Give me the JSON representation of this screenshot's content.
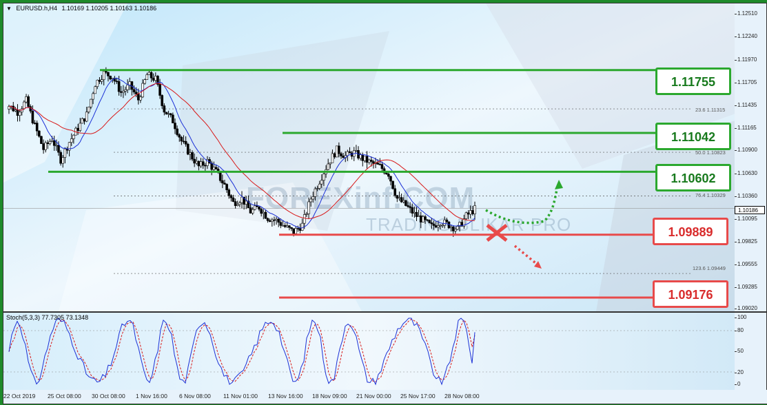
{
  "chart_header": {
    "menu_icon": "triangle-down-icon",
    "symbol": "EURUSD.h,H4",
    "ohlc": "1.10169 1.10205 1.10163 1.10186"
  },
  "stoch_header": {
    "label": "Stoch(5,3,3) 77.7305 73.1348"
  },
  "price_axis": {
    "ticks": [
      "1.12510",
      "1.12240",
      "1.11970",
      "1.11705",
      "1.11435",
      "1.11165",
      "1.10900",
      "1.10630",
      "1.10360",
      "1.10095",
      "1.09825",
      "1.09555",
      "1.09285",
      "1.09020"
    ],
    "current_price": "1.10186"
  },
  "stoch_axis": {
    "ticks": [
      "100",
      "80",
      "50",
      "20",
      "0"
    ]
  },
  "time_axis": {
    "labels": [
      "22 Oct 2019",
      "25 Oct 08:00",
      "30 Oct 08:00",
      "1 Nov 16:00",
      "6 Nov 08:00",
      "11 Nov 01:00",
      "13 Nov 16:00",
      "18 Nov 09:00",
      "21 Nov 00:00",
      "25 Nov 17:00",
      "28 Nov 08:00"
    ]
  },
  "levels": [
    {
      "price": "1.11755",
      "color": "green"
    },
    {
      "price": "1.11042",
      "color": "green"
    },
    {
      "price": "1.10602",
      "color": "green"
    },
    {
      "price": "1.09889",
      "color": "red"
    },
    {
      "price": "1.09176",
      "color": "red"
    }
  ],
  "fib_labels": [
    "23.6 1.11315",
    "50.0 1.10823",
    "76.4 1.10329",
    "123.6 1.09449"
  ],
  "watermark": {
    "brand": "FOREXinf.COM",
    "sub": "TRADING BLIKAR PRO"
  },
  "colors": {
    "frame": "#1e8a2a",
    "support_green": "#2ba82e",
    "resistance_red": "#e84a4a",
    "ma_fast": "#1a2fd6",
    "ma_slow": "#d81818",
    "stoch_main": "#1a2fd6",
    "stoch_signal": "#d81818"
  },
  "chart_data": {
    "type": "candlestick",
    "symbol": "EURUSD.h",
    "timeframe": "H4",
    "ylim": [
      1.0902,
      1.1251
    ],
    "horizontal_levels": [
      1.11755,
      1.11042,
      1.10602,
      1.09889,
      1.09176
    ],
    "fibonacci": [
      {
        "ratio": "23.6",
        "price": 1.11315
      },
      {
        "ratio": "50.0",
        "price": 1.10823
      },
      {
        "ratio": "76.4",
        "price": 1.10329
      },
      {
        "ratio": "123.6",
        "price": 1.09449
      }
    ],
    "current_price": 1.10186,
    "close_path": [
      1.1135,
      1.1128,
      1.1141,
      1.1112,
      1.1086,
      1.1098,
      1.1074,
      1.1094,
      1.111,
      1.1125,
      1.116,
      1.1172,
      1.1168,
      1.115,
      1.1158,
      1.1142,
      1.117,
      1.1165,
      1.113,
      1.1118,
      1.1095,
      1.108,
      1.1066,
      1.1072,
      1.106,
      1.1045,
      1.1025,
      1.103,
      1.1015,
      1.102,
      1.1008,
      1.1005,
      1.0998,
      1.0992,
      1.1,
      1.103,
      1.105,
      1.107,
      1.1085,
      1.1078,
      1.1082,
      1.1075,
      1.107,
      1.1066,
      1.1058,
      1.103,
      1.1022,
      1.1012,
      1.1005,
      1.0998,
      1.1004,
      1.1,
      1.0995,
      1.101,
      1.1018
    ],
    "stochastic": {
      "label": "Stoch(5,3,3)",
      "k": 77.7305,
      "d": 73.1348,
      "levels": [
        20,
        80
      ],
      "ylim": [
        0,
        100
      ]
    }
  }
}
